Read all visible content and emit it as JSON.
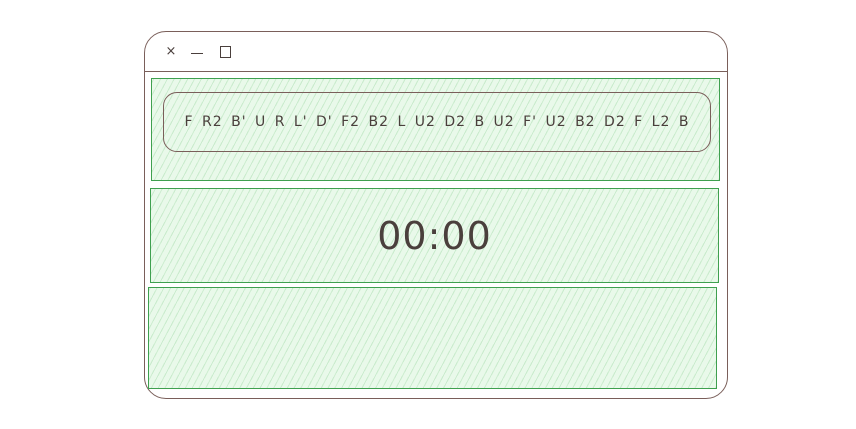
{
  "window": {
    "controls": {
      "close": "×",
      "minimize": "",
      "maximize": ""
    }
  },
  "scramble": {
    "text": "F R2 B' U R L' D' F2 B2 L U2 D2 B U2 F' U2 B2 D2 F L2 B"
  },
  "timer": {
    "value": "00:00"
  },
  "colors": {
    "panel_border": "#3fa04f",
    "panel_fill": "#e9f9ea",
    "window_border": "#7a5f5a",
    "text": "#4a3f3c"
  }
}
